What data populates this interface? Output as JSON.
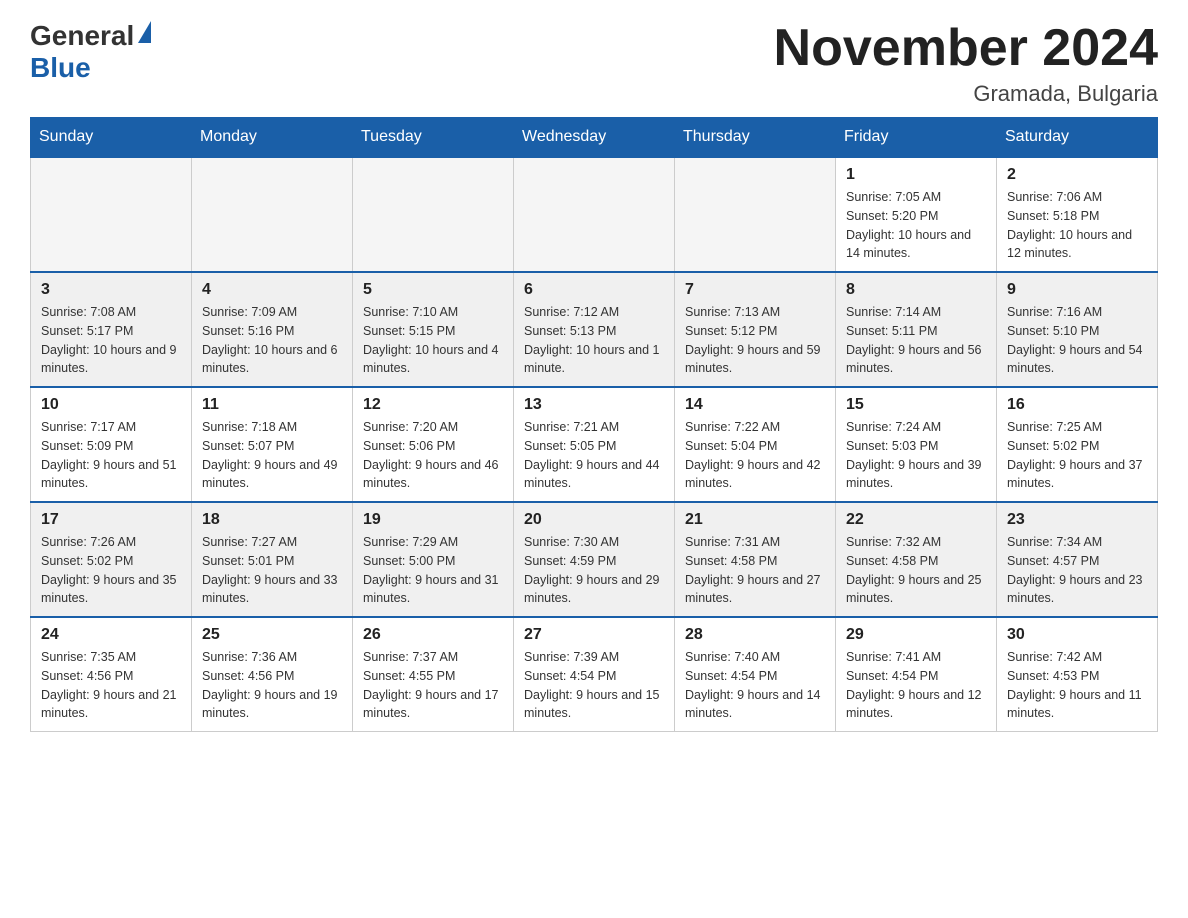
{
  "header": {
    "logo_general": "General",
    "logo_blue": "Blue",
    "month_title": "November 2024",
    "location": "Gramada, Bulgaria"
  },
  "days_of_week": [
    "Sunday",
    "Monday",
    "Tuesday",
    "Wednesday",
    "Thursday",
    "Friday",
    "Saturday"
  ],
  "weeks": [
    [
      {
        "day": "",
        "info": ""
      },
      {
        "day": "",
        "info": ""
      },
      {
        "day": "",
        "info": ""
      },
      {
        "day": "",
        "info": ""
      },
      {
        "day": "",
        "info": ""
      },
      {
        "day": "1",
        "info": "Sunrise: 7:05 AM\nSunset: 5:20 PM\nDaylight: 10 hours and 14 minutes."
      },
      {
        "day": "2",
        "info": "Sunrise: 7:06 AM\nSunset: 5:18 PM\nDaylight: 10 hours and 12 minutes."
      }
    ],
    [
      {
        "day": "3",
        "info": "Sunrise: 7:08 AM\nSunset: 5:17 PM\nDaylight: 10 hours and 9 minutes."
      },
      {
        "day": "4",
        "info": "Sunrise: 7:09 AM\nSunset: 5:16 PM\nDaylight: 10 hours and 6 minutes."
      },
      {
        "day": "5",
        "info": "Sunrise: 7:10 AM\nSunset: 5:15 PM\nDaylight: 10 hours and 4 minutes."
      },
      {
        "day": "6",
        "info": "Sunrise: 7:12 AM\nSunset: 5:13 PM\nDaylight: 10 hours and 1 minute."
      },
      {
        "day": "7",
        "info": "Sunrise: 7:13 AM\nSunset: 5:12 PM\nDaylight: 9 hours and 59 minutes."
      },
      {
        "day": "8",
        "info": "Sunrise: 7:14 AM\nSunset: 5:11 PM\nDaylight: 9 hours and 56 minutes."
      },
      {
        "day": "9",
        "info": "Sunrise: 7:16 AM\nSunset: 5:10 PM\nDaylight: 9 hours and 54 minutes."
      }
    ],
    [
      {
        "day": "10",
        "info": "Sunrise: 7:17 AM\nSunset: 5:09 PM\nDaylight: 9 hours and 51 minutes."
      },
      {
        "day": "11",
        "info": "Sunrise: 7:18 AM\nSunset: 5:07 PM\nDaylight: 9 hours and 49 minutes."
      },
      {
        "day": "12",
        "info": "Sunrise: 7:20 AM\nSunset: 5:06 PM\nDaylight: 9 hours and 46 minutes."
      },
      {
        "day": "13",
        "info": "Sunrise: 7:21 AM\nSunset: 5:05 PM\nDaylight: 9 hours and 44 minutes."
      },
      {
        "day": "14",
        "info": "Sunrise: 7:22 AM\nSunset: 5:04 PM\nDaylight: 9 hours and 42 minutes."
      },
      {
        "day": "15",
        "info": "Sunrise: 7:24 AM\nSunset: 5:03 PM\nDaylight: 9 hours and 39 minutes."
      },
      {
        "day": "16",
        "info": "Sunrise: 7:25 AM\nSunset: 5:02 PM\nDaylight: 9 hours and 37 minutes."
      }
    ],
    [
      {
        "day": "17",
        "info": "Sunrise: 7:26 AM\nSunset: 5:02 PM\nDaylight: 9 hours and 35 minutes."
      },
      {
        "day": "18",
        "info": "Sunrise: 7:27 AM\nSunset: 5:01 PM\nDaylight: 9 hours and 33 minutes."
      },
      {
        "day": "19",
        "info": "Sunrise: 7:29 AM\nSunset: 5:00 PM\nDaylight: 9 hours and 31 minutes."
      },
      {
        "day": "20",
        "info": "Sunrise: 7:30 AM\nSunset: 4:59 PM\nDaylight: 9 hours and 29 minutes."
      },
      {
        "day": "21",
        "info": "Sunrise: 7:31 AM\nSunset: 4:58 PM\nDaylight: 9 hours and 27 minutes."
      },
      {
        "day": "22",
        "info": "Sunrise: 7:32 AM\nSunset: 4:58 PM\nDaylight: 9 hours and 25 minutes."
      },
      {
        "day": "23",
        "info": "Sunrise: 7:34 AM\nSunset: 4:57 PM\nDaylight: 9 hours and 23 minutes."
      }
    ],
    [
      {
        "day": "24",
        "info": "Sunrise: 7:35 AM\nSunset: 4:56 PM\nDaylight: 9 hours and 21 minutes."
      },
      {
        "day": "25",
        "info": "Sunrise: 7:36 AM\nSunset: 4:56 PM\nDaylight: 9 hours and 19 minutes."
      },
      {
        "day": "26",
        "info": "Sunrise: 7:37 AM\nSunset: 4:55 PM\nDaylight: 9 hours and 17 minutes."
      },
      {
        "day": "27",
        "info": "Sunrise: 7:39 AM\nSunset: 4:54 PM\nDaylight: 9 hours and 15 minutes."
      },
      {
        "day": "28",
        "info": "Sunrise: 7:40 AM\nSunset: 4:54 PM\nDaylight: 9 hours and 14 minutes."
      },
      {
        "day": "29",
        "info": "Sunrise: 7:41 AM\nSunset: 4:54 PM\nDaylight: 9 hours and 12 minutes."
      },
      {
        "day": "30",
        "info": "Sunrise: 7:42 AM\nSunset: 4:53 PM\nDaylight: 9 hours and 11 minutes."
      }
    ]
  ]
}
